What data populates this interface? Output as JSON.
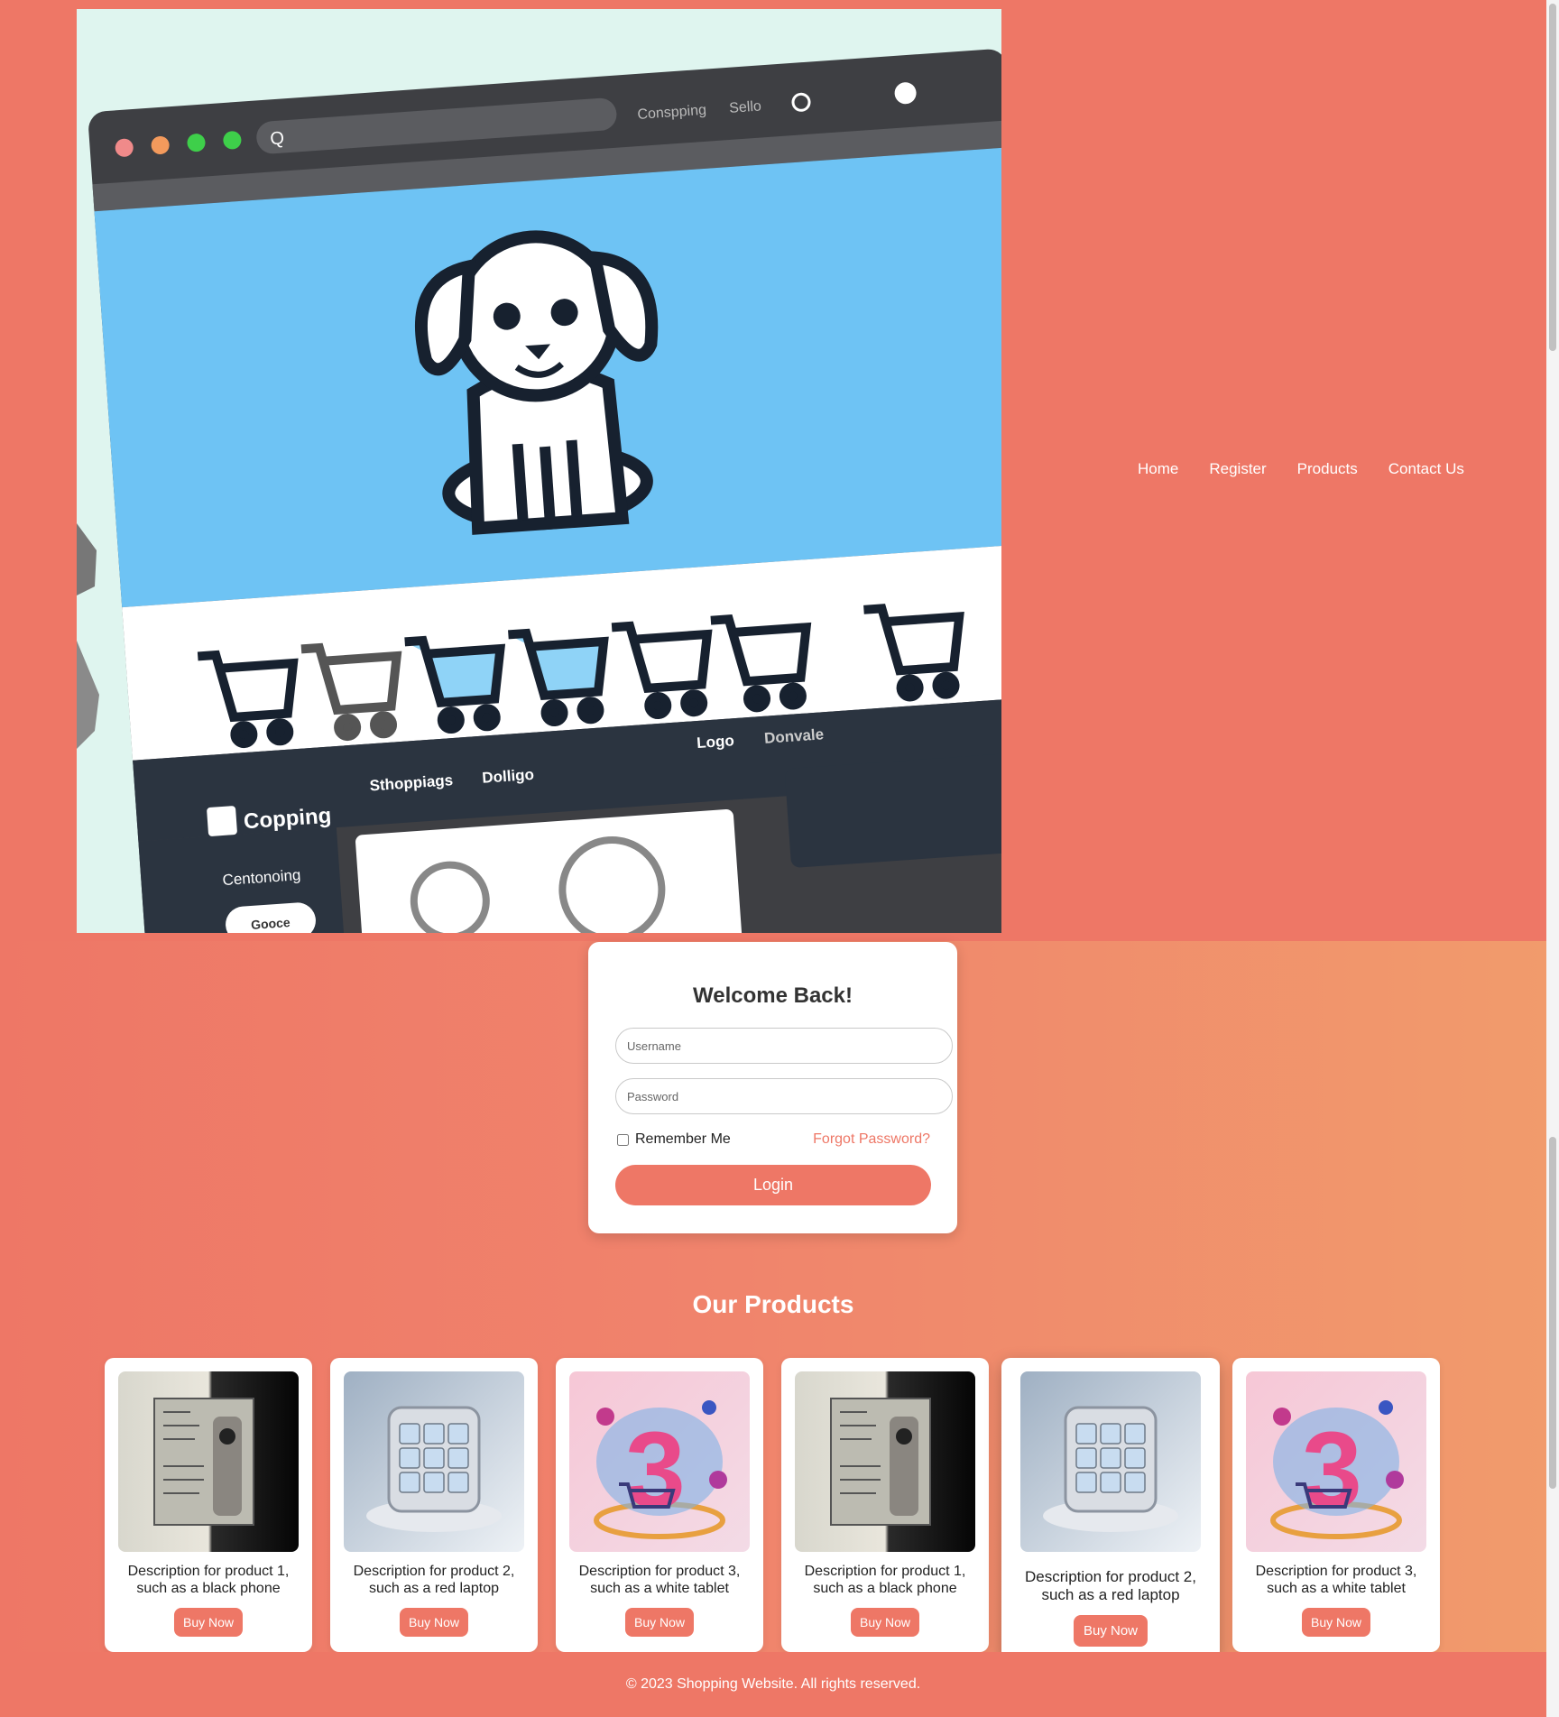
{
  "nav": {
    "items": [
      "Home",
      "Register",
      "Products",
      "Contact Us"
    ]
  },
  "hero": {
    "address_bar_text": "Q",
    "top_links": [
      "Conspping",
      "Sello"
    ],
    "nav_text": [
      "Sthoppiags",
      "Dolligo",
      "Logo",
      "Donvale"
    ],
    "logo_text": "Copping",
    "sidebar_text": "Centonoing",
    "sidebar_button": "Gooce"
  },
  "login": {
    "title": "Welcome Back!",
    "username_placeholder": "Username",
    "password_placeholder": "Password",
    "remember_label": "Remember Me",
    "forgot_label": "Forgot Password?",
    "login_label": "Login"
  },
  "products": {
    "title": "Our Products",
    "buy_label": "Buy Now",
    "items": [
      {
        "desc": "Description for product 1, such as a black phone",
        "image": "product-1-image"
      },
      {
        "desc": "Description for product 2, such as a red laptop",
        "image": "product-2-image"
      },
      {
        "desc": "Description for product 3, such as a white tablet",
        "image": "product-3-image"
      },
      {
        "desc": "Description for product 1, such as a black phone",
        "image": "product-1-image"
      },
      {
        "desc": "Description for product 2, such as a red laptop",
        "image": "product-2-image"
      },
      {
        "desc": "Description for product 3, such as a white tablet",
        "image": "product-3-image"
      }
    ]
  },
  "footer": {
    "text": "© 2023 Shopping Website. All rights reserved."
  },
  "colors": {
    "accent": "#ee7766",
    "gradient_end": "#f19b6c",
    "hero_blue": "#6ec3f4",
    "dark_nav": "#2b3440"
  }
}
